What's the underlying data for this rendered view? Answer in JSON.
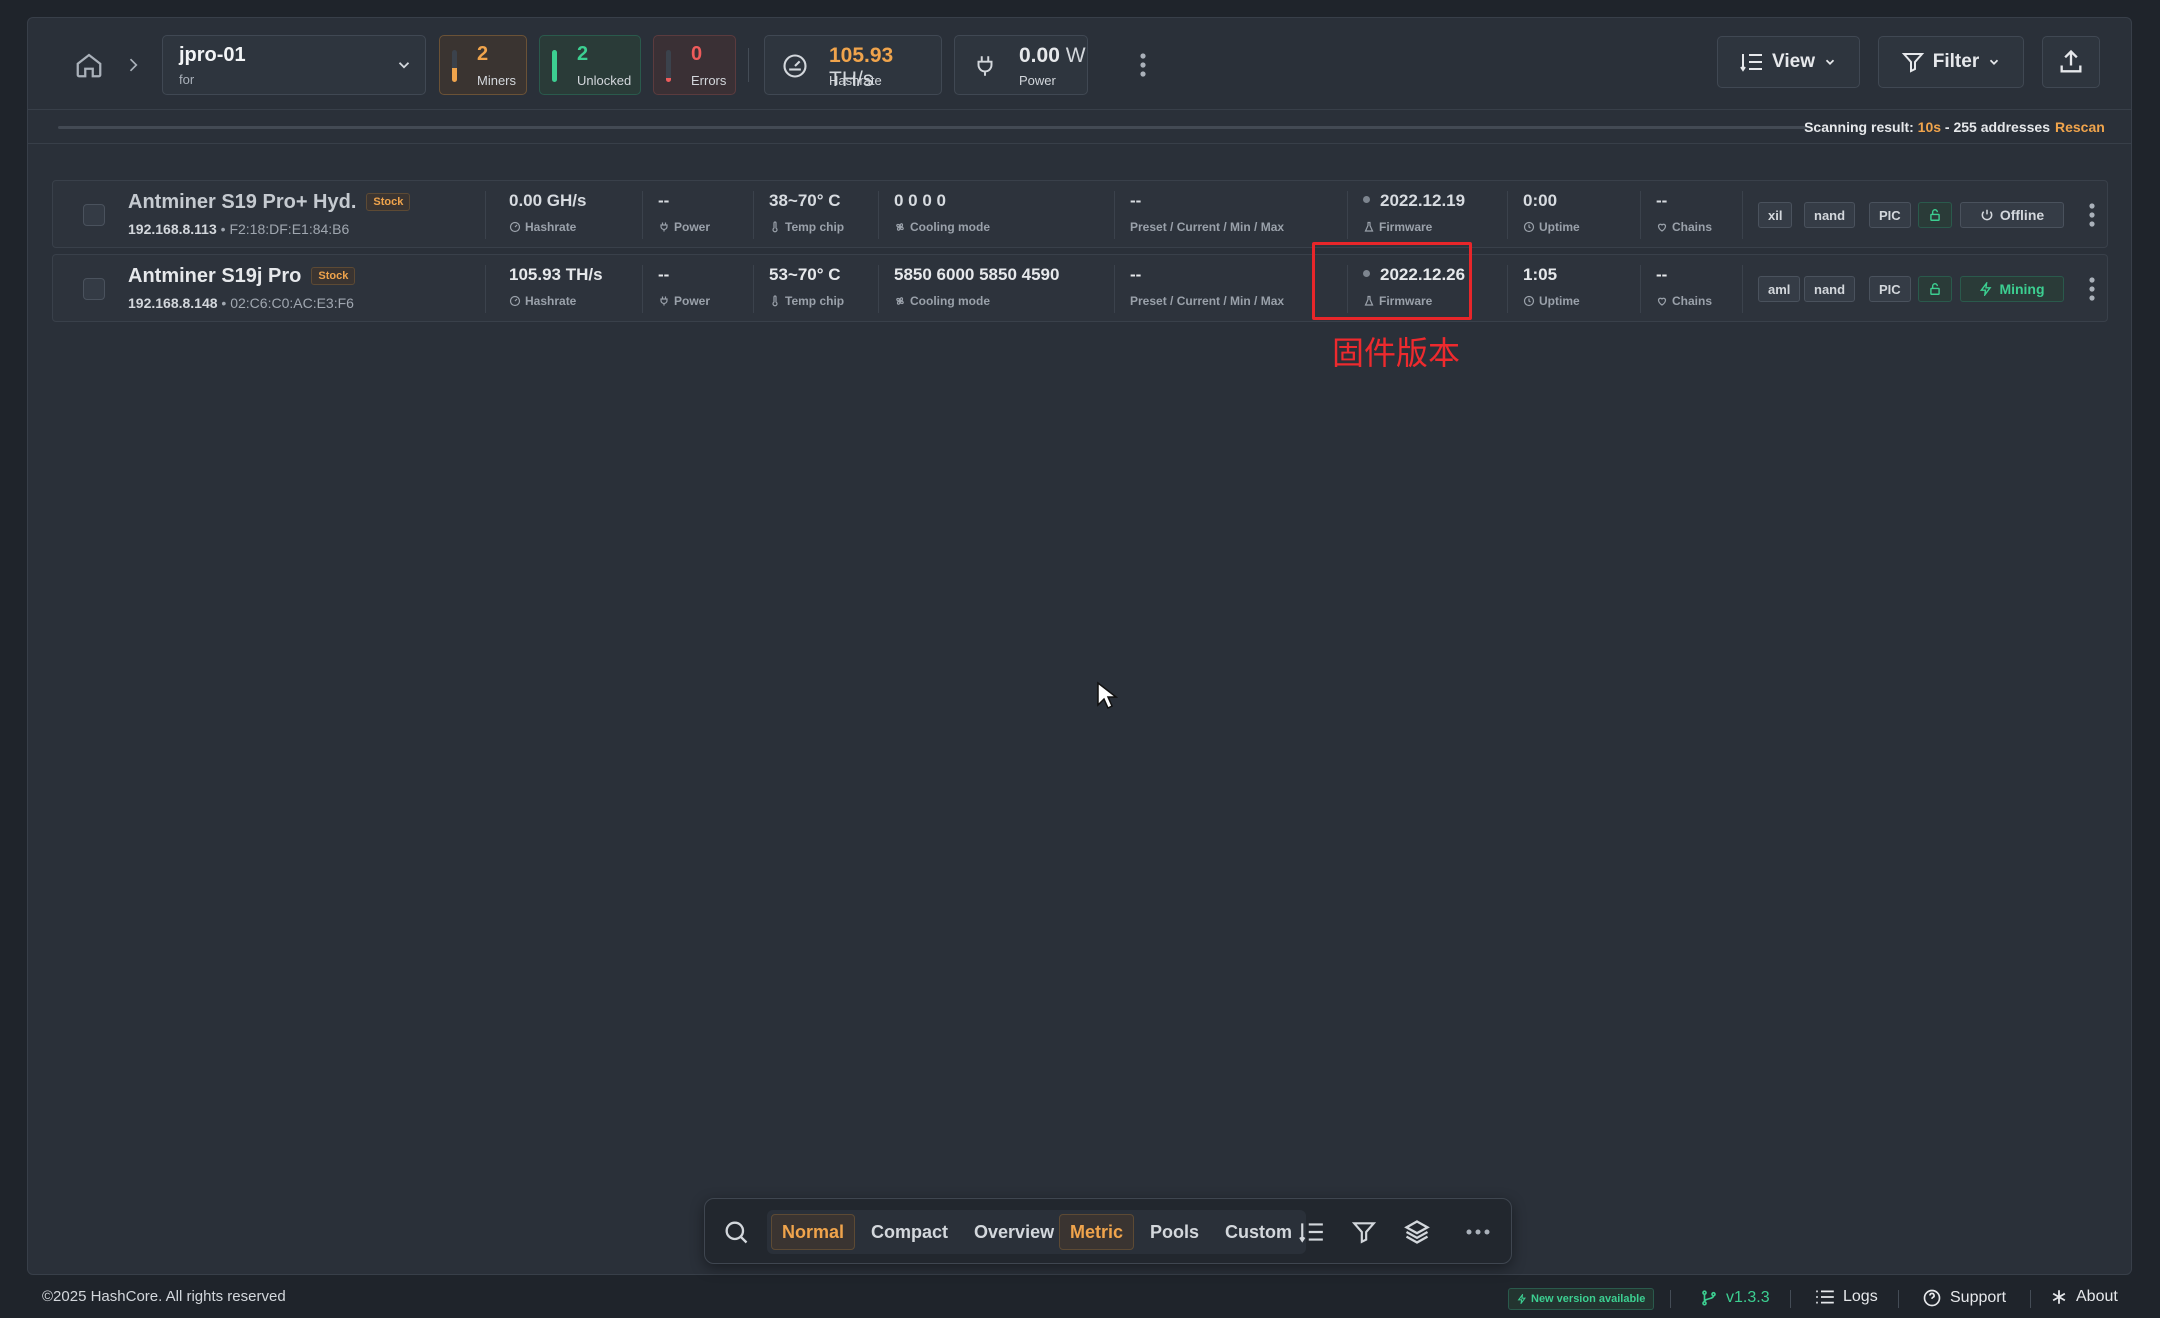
{
  "header": {
    "workspace": {
      "title": "jpro-01",
      "subtitle": "for"
    },
    "stats": {
      "miners": {
        "value": "2",
        "label": "Miners",
        "color": "#f0a44c"
      },
      "unlocked": {
        "value": "2",
        "label": "Unlocked",
        "color": "#3ccf91"
      },
      "errors": {
        "value": "0",
        "label": "Errors",
        "color": "#ef5b5b"
      }
    },
    "hashrate": {
      "value": "105.93",
      "unit": "TH/s",
      "label": "Hashrate"
    },
    "power": {
      "value": "0.00",
      "unit": "W",
      "label": "Power"
    },
    "view_label": "View",
    "filter_label": "Filter"
  },
  "scan": {
    "prefix": "Scanning result: ",
    "time": "10s",
    "suffix": " - 255 addresses",
    "rescan": "Rescan"
  },
  "rows": [
    {
      "name": "Antminer S19 Pro+ Hyd.",
      "badge": "Stock",
      "ip": "192.168.8.113",
      "mac": "F2:18:DF:E1:84:B6",
      "hashrate": "0.00 GH/s",
      "hashrate_label": "Hashrate",
      "power": "--",
      "power_label": "Power",
      "temp": "38~70° C",
      "temp_label": "Temp chip",
      "cooling": "0  0  0  0",
      "cooling_label": "Cooling mode",
      "preset": "--",
      "preset_label": "Preset / Current / Min / Max",
      "firmware": "2022.12.19",
      "firmware_label": "Firmware",
      "uptime": "0:00",
      "uptime_label": "Uptime",
      "chains": "--",
      "chains_label": "Chains",
      "tags": [
        "xil",
        "nand",
        "PIC"
      ],
      "status": "Offline"
    },
    {
      "name": "Antminer S19j Pro",
      "badge": "Stock",
      "ip": "192.168.8.148",
      "mac": "02:C6:C0:AC:E3:F6",
      "hashrate": "105.93 TH/s",
      "hashrate_label": "Hashrate",
      "power": "--",
      "power_label": "Power",
      "temp": "53~70° C",
      "temp_label": "Temp chip",
      "cooling": "5850  6000  5850  4590",
      "cooling_label": "Cooling mode",
      "preset": "--",
      "preset_label": "Preset / Current / Min / Max",
      "firmware": "2022.12.26",
      "firmware_label": "Firmware",
      "uptime": "1:05",
      "uptime_label": "Uptime",
      "chains": "--",
      "chains_label": "Chains",
      "tags": [
        "aml",
        "nand",
        "PIC"
      ],
      "status": "Mining"
    }
  ],
  "annotation": {
    "text": "固件版本",
    "color": "#e8262a"
  },
  "toolbar": {
    "layouts": [
      "Normal",
      "Compact",
      "Overview"
    ],
    "modes": [
      "Metric",
      "Pools",
      "Custom"
    ]
  },
  "footer": {
    "copyright": "©2025 HashCore. All rights reserved",
    "new_version": "New version available",
    "version": "v1.3.3",
    "logs": "Logs",
    "support": "Support",
    "about": "About"
  }
}
